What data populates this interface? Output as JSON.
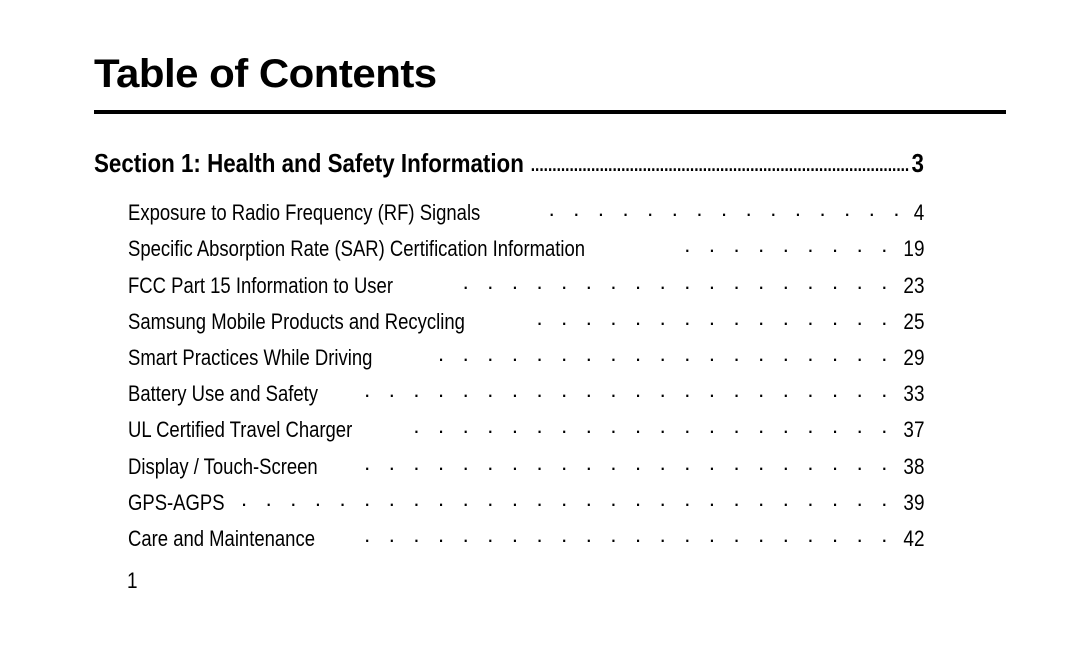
{
  "title": "Table of Contents",
  "section": {
    "label": "Section 1:  Health and Safety Information",
    "page": "3"
  },
  "entries": [
    {
      "label": "Exposure to Radio Frequency (RF) Signals",
      "page": "4"
    },
    {
      "label": "Specific Absorption Rate (SAR) Certification Information",
      "page": "19"
    },
    {
      "label": "FCC Part 15 Information to User",
      "page": "23"
    },
    {
      "label": "Samsung Mobile Products and Recycling",
      "page": "25"
    },
    {
      "label": "Smart Practices While Driving",
      "page": "29"
    },
    {
      "label": "Battery Use and Safety",
      "page": "33"
    },
    {
      "label": "UL Certified Travel Charger",
      "page": "37"
    },
    {
      "label": "Display / Touch-Screen",
      "page": "38"
    },
    {
      "label": "GPS-AGPS",
      "page": "39"
    },
    {
      "label": "Care and Maintenance",
      "page": "42"
    }
  ],
  "page_number": "1",
  "leader_char": ".",
  "leader_text": " . . . . . . . . . . . . . . . . . . . . . . . . . . . . . . . . . . . . . . . . . . . . . . . . . . . . . . . . . . . .",
  "section_leader_text": "......................................................................................................"
}
